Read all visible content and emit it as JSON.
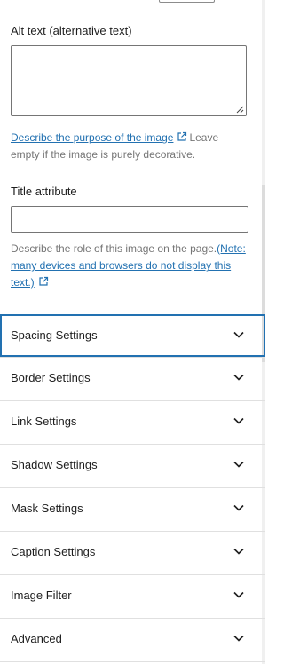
{
  "alt_text": {
    "label": "Alt text (alternative text)",
    "value": "",
    "help_link": "Describe the purpose of the image",
    "help_tail": "Leave empty if the image is purely decorative."
  },
  "title_attribute": {
    "label": "Title attribute",
    "value": "",
    "help_text": "Describe the role of this image on the page.",
    "help_link": "(Note: many devices and browsers do not display this text.)"
  },
  "panels": [
    {
      "label": "Spacing Settings"
    },
    {
      "label": "Border Settings"
    },
    {
      "label": "Link Settings"
    },
    {
      "label": "Shadow Settings"
    },
    {
      "label": "Mask Settings"
    },
    {
      "label": "Caption Settings"
    },
    {
      "label": "Image Filter"
    },
    {
      "label": "Advanced"
    }
  ],
  "colors": {
    "accent": "#2271b1",
    "border": "#757575",
    "divider": "#e0e0e0",
    "help_text": "#757575"
  }
}
